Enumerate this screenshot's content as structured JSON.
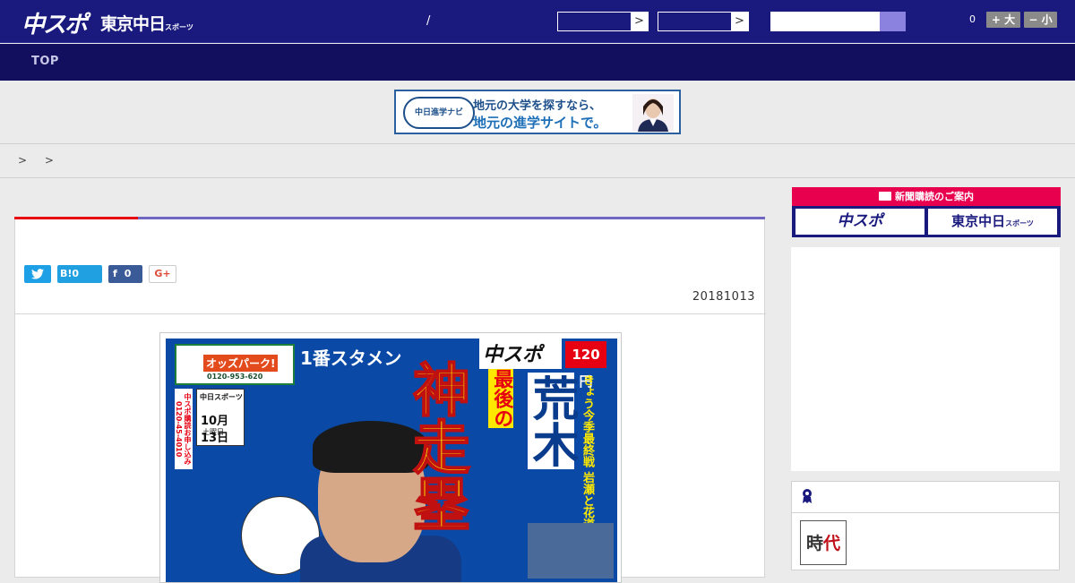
{
  "header": {
    "logo_primary": "中スポ",
    "logo_secondary": "東京中日",
    "logo_secondary_small": "スポーツ",
    "slash": "/",
    "select1_arrow": ">",
    "select2_arrow": ">",
    "font_count": "0",
    "font_larger": "+ 大",
    "font_smaller": "− 小"
  },
  "nav": {
    "top": "TOP"
  },
  "banner": {
    "badge": "中日進学ナビ",
    "line1": "地元の大学を探すなら、",
    "line2": "地元の進学サイトで。"
  },
  "breadcrumb": "> >",
  "article": {
    "share_twitter_icon": "twitter-icon",
    "hatena_label": "B!",
    "hatena_count": "0",
    "facebook_label": "f",
    "facebook_count": "0",
    "gplus_label": "G+",
    "date": "20181013"
  },
  "front_page": {
    "odds_title": "オッズパーク!",
    "odds_tel": "0120-953-620",
    "headline_top": "1番スタメン",
    "paper_logo": "中スポ",
    "price": "120円",
    "date_box_logo": "中日スポーツ",
    "date_box_date": "10月13日",
    "date_box_dow": "土曜日",
    "subscribe_col": "中スポ購読お申し込み 0120-45-4010",
    "big_headline": "神走塁",
    "saigo": "最後の",
    "araki": "荒木",
    "side_yellow": "きょう今季最終戦 岩瀬と花道"
  },
  "sidebar": {
    "subscribe_head": "新聞購読のご案内",
    "subscribe_btn1": "中スポ",
    "subscribe_btn2": "東京中日",
    "subscribe_btn2_small": "スポーツ",
    "rank_thumb_a": "時",
    "rank_thumb_b": "代"
  },
  "colors": {
    "header_bg": "#1a1a7e",
    "nav_bg": "#12105e",
    "accent_red": "#e60012",
    "accent_pink": "#e8004f",
    "accent_blue": "#7068c0"
  }
}
